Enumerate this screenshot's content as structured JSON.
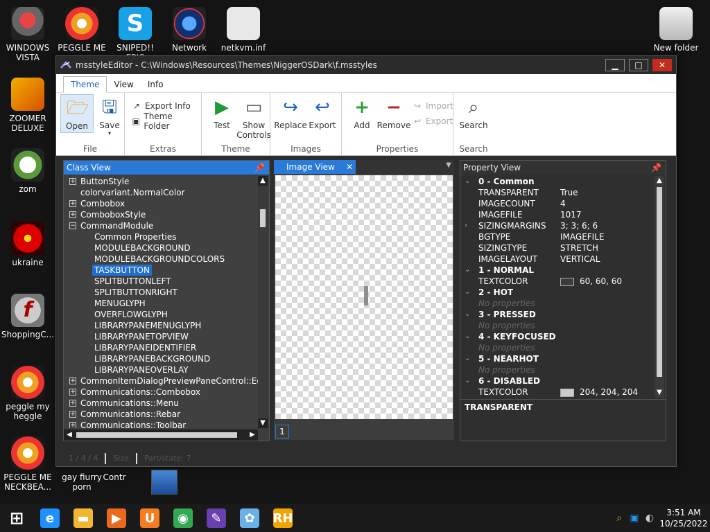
{
  "desktop": {
    "icons": [
      {
        "label": "WINDOWS VISTA",
        "icon": "vista-orb-icon"
      },
      {
        "label": "PEGGLE ME",
        "icon": "peggle-icon"
      },
      {
        "label": "SNIPED!! EPIC",
        "icon": "skype-icon"
      },
      {
        "label": "Network",
        "icon": "network-icon"
      },
      {
        "label": "netkvm.inf",
        "icon": "inf-file-icon"
      },
      {
        "label": "New folder",
        "icon": "folder-icon"
      },
      {
        "label": "ZOOMER DELUXE",
        "icon": "zoomer-icon"
      },
      {
        "label": "zom",
        "icon": "flower-icon"
      },
      {
        "label": "ukraine",
        "icon": "radiation-icon"
      },
      {
        "label": "ShoppingC...",
        "icon": "flash-icon"
      },
      {
        "label": "peggle my heggle",
        "icon": "peggle-icon"
      },
      {
        "label": "PEGGLE ME NECKBEA...",
        "icon": "peggle-icon"
      },
      {
        "label": "gay fiurry porn",
        "icon": "file-icon"
      },
      {
        "label": "Contr",
        "icon": "file-icon"
      }
    ]
  },
  "window": {
    "title": "msstyleEditor - C:\\Windows\\Resources\\Themes\\NiggerOSDark\\f.msstyles",
    "minimize": "▁",
    "maximize": "□",
    "close": "✕"
  },
  "ribbon": {
    "tabs": [
      "Theme",
      "View",
      "Info"
    ],
    "groups": {
      "file": {
        "name": "File",
        "open": "Open",
        "save": "Save"
      },
      "extras": {
        "name": "Extras",
        "export_info": "Export Info",
        "theme_folder": "Theme Folder"
      },
      "theme": {
        "name": "Theme",
        "test": "Test",
        "show_controls": "Show Controls"
      },
      "images": {
        "name": "Images",
        "replace": "Replace",
        "export": "Export"
      },
      "properties": {
        "name": "Properties",
        "add": "Add",
        "remove": "Remove",
        "import": "Import",
        "export": "Export"
      },
      "search": {
        "name": "Search",
        "search": "Search"
      }
    }
  },
  "class_view": {
    "title": "Class View",
    "rows": [
      {
        "text": "ButtonStyle",
        "level": 0,
        "expander": "+"
      },
      {
        "text": "colorvariant.NormalColor",
        "level": 0,
        "expander": ""
      },
      {
        "text": "Combobox",
        "level": 0,
        "expander": "+"
      },
      {
        "text": "ComboboxStyle",
        "level": 0,
        "expander": "+"
      },
      {
        "text": "CommandModule",
        "level": 0,
        "expander": "−"
      },
      {
        "text": "Common Properties",
        "level": 1,
        "expander": ""
      },
      {
        "text": "MODULEBACKGROUND",
        "level": 1,
        "expander": ""
      },
      {
        "text": "MODULEBACKGROUNDCOLORS",
        "level": 1,
        "expander": ""
      },
      {
        "text": "TASKBUTTON",
        "level": 1,
        "expander": "",
        "selected": true
      },
      {
        "text": "SPLITBUTTONLEFT",
        "level": 1,
        "expander": ""
      },
      {
        "text": "SPLITBUTTONRIGHT",
        "level": 1,
        "expander": ""
      },
      {
        "text": "MENUGLYPH",
        "level": 1,
        "expander": ""
      },
      {
        "text": "OVERFLOWGLYPH",
        "level": 1,
        "expander": ""
      },
      {
        "text": "LIBRARYPANEMENUGLYPH",
        "level": 1,
        "expander": ""
      },
      {
        "text": "LIBRARYPANETOPVIEW",
        "level": 1,
        "expander": ""
      },
      {
        "text": "LIBRARYPANEIDENTIFIER",
        "level": 1,
        "expander": ""
      },
      {
        "text": "LIBRARYPANEBACKGROUND",
        "level": 1,
        "expander": ""
      },
      {
        "text": "LIBRARYPANEOVERLAY",
        "level": 1,
        "expander": ""
      },
      {
        "text": "CommonItemDialogPreviewPaneControl::Edit",
        "level": 0,
        "expander": "+"
      },
      {
        "text": "Communications::Combobox",
        "level": 0,
        "expander": "+"
      },
      {
        "text": "Communications::Menu",
        "level": 0,
        "expander": "+"
      },
      {
        "text": "Communications::Rebar",
        "level": 0,
        "expander": "+"
      },
      {
        "text": "Communications::Toolbar",
        "level": 0,
        "expander": "+"
      }
    ]
  },
  "image_view": {
    "tab": "Image View",
    "page": "1"
  },
  "property_view": {
    "title": "Property View",
    "rows": [
      {
        "type": "group",
        "key": "0 - Common",
        "value": ""
      },
      {
        "type": "prop",
        "key": "TRANSPARENT",
        "value": "True"
      },
      {
        "type": "prop",
        "key": "IMAGECOUNT",
        "value": "4"
      },
      {
        "type": "prop",
        "key": "IMAGEFILE",
        "value": "1017"
      },
      {
        "type": "prop",
        "key": "SIZINGMARGINS",
        "value": "3; 3; 6; 6",
        "chev": "›"
      },
      {
        "type": "prop",
        "key": "BGTYPE",
        "value": "IMAGEFILE"
      },
      {
        "type": "prop",
        "key": "SIZINGTYPE",
        "value": "STRETCH"
      },
      {
        "type": "prop",
        "key": "IMAGELAYOUT",
        "value": "VERTICAL"
      },
      {
        "type": "group",
        "key": "1 - NORMAL",
        "value": ""
      },
      {
        "type": "color",
        "key": "TEXTCOLOR",
        "value": "60, 60, 60",
        "swatch": "#3c3c3c"
      },
      {
        "type": "group",
        "key": "2 - HOT",
        "value": ""
      },
      {
        "type": "empty",
        "key": "No properties",
        "value": ""
      },
      {
        "type": "group",
        "key": "3 - PRESSED",
        "value": ""
      },
      {
        "type": "empty",
        "key": "No properties",
        "value": ""
      },
      {
        "type": "group",
        "key": "4 - KEYFOCUSED",
        "value": ""
      },
      {
        "type": "empty",
        "key": "No properties",
        "value": ""
      },
      {
        "type": "group",
        "key": "5 - NEARHOT",
        "value": ""
      },
      {
        "type": "empty",
        "key": "No properties",
        "value": ""
      },
      {
        "type": "group",
        "key": "6 - DISABLED",
        "value": ""
      },
      {
        "type": "color",
        "key": "TEXTCOLOR",
        "value": "204, 204, 204",
        "swatch": "#cccccc"
      }
    ],
    "description": "TRANSPARENT"
  },
  "statusbar": {
    "segments": [
      "1 / 4 / 4",
      "Size",
      "Part/state: 7"
    ]
  },
  "taskbar": {
    "apps": [
      {
        "name": "internet-explorer-icon",
        "glyph": "e",
        "color": "#1e90ff"
      },
      {
        "name": "file-explorer-icon",
        "glyph": "▬",
        "color": "#f2b630"
      },
      {
        "name": "media-player-icon",
        "glyph": "▶",
        "color": "#e86a1a"
      },
      {
        "name": "uc-browser-icon",
        "glyph": "U",
        "color": "#f57c1f"
      },
      {
        "name": "chrome-icon",
        "glyph": "◉",
        "color": "#34a853"
      },
      {
        "name": "msstyle-editor-icon",
        "glyph": "✎",
        "color": "#6a3fb0"
      },
      {
        "name": "paint-icon",
        "glyph": "✿",
        "color": "#6ab0e8"
      },
      {
        "name": "rh-icon",
        "glyph": "RH",
        "color": "#f0a400"
      }
    ],
    "clock": {
      "time": "3:51 AM",
      "date": "10/25/2022"
    }
  },
  "colors": {
    "accent": "#2a7ad8",
    "close_red": "#c42b1c"
  }
}
